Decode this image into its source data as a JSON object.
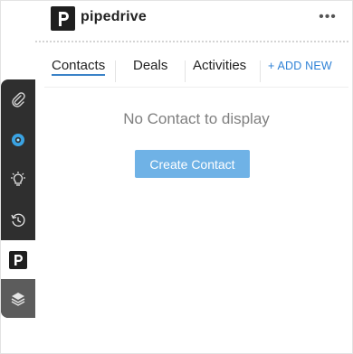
{
  "header": {
    "brand": "pipedrive",
    "more_label": "•••"
  },
  "tabs": [
    {
      "label": "Contacts",
      "active": true
    },
    {
      "label": "Deals",
      "active": false
    },
    {
      "label": "Activities",
      "active": false
    }
  ],
  "add_new_label": "+ ADD NEW",
  "empty_message": "No Contact to display",
  "create_button_label": "Create Contact",
  "sidebar": {
    "items": [
      {
        "icon": "paperclip-icon"
      },
      {
        "icon": "crm-logo-icon"
      },
      {
        "icon": "lightbulb-icon"
      },
      {
        "icon": "history-icon"
      },
      {
        "icon": "pipedrive-icon",
        "active": true
      },
      {
        "icon": "layers-icon"
      }
    ]
  },
  "colors": {
    "accent": "#2f82d6",
    "button": "#6fb2e6",
    "sidebar": "#2f2f2f"
  }
}
